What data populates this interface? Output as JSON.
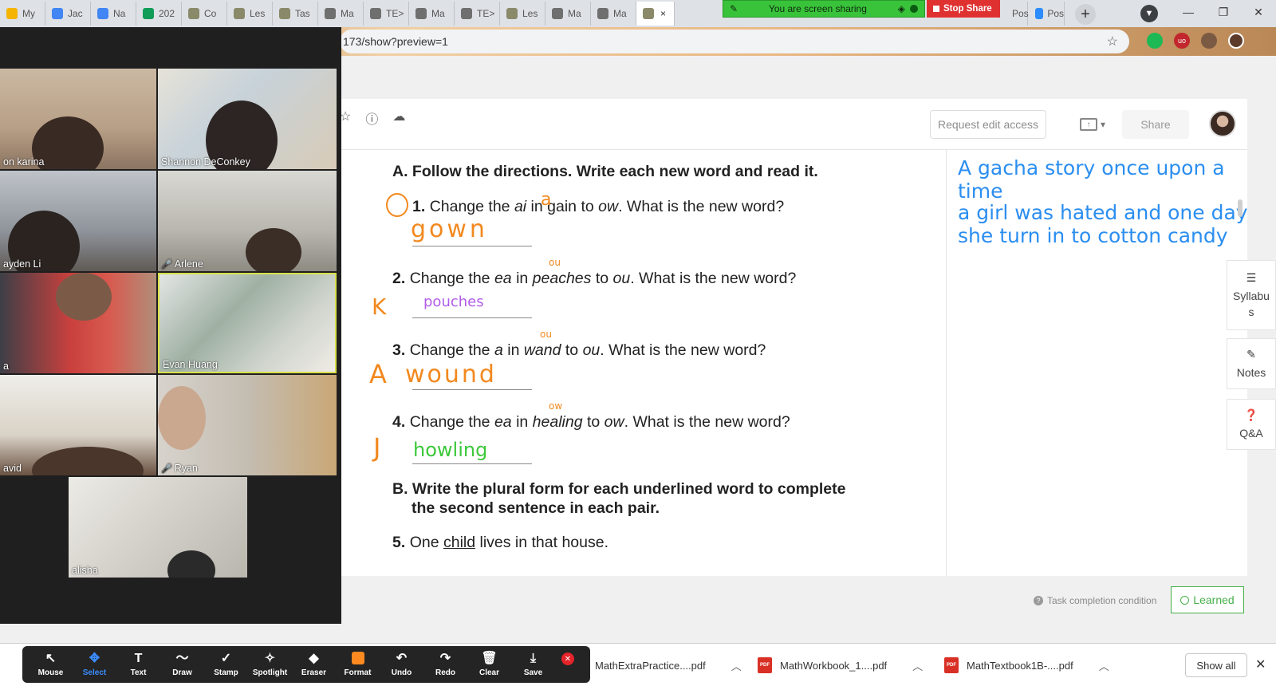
{
  "browser": {
    "tabs": [
      {
        "label": "My",
        "color": "#f4b400"
      },
      {
        "label": "Jac",
        "color": "#4285f4"
      },
      {
        "label": "Na",
        "color": "#4285f4"
      },
      {
        "label": "202",
        "color": "#0f9d58"
      },
      {
        "label": "Co",
        "color": "#8a8a6a"
      },
      {
        "label": "Les",
        "color": "#8a8a6a"
      },
      {
        "label": "Tas",
        "color": "#8a8a6a"
      },
      {
        "label": "Ma",
        "color": "#6f6f6f"
      },
      {
        "label": "TE>",
        "color": "#6f6f6f"
      },
      {
        "label": "Ma",
        "color": "#6f6f6f"
      },
      {
        "label": "TE>",
        "color": "#6f6f6f"
      },
      {
        "label": "Les",
        "color": "#8a8a6a"
      },
      {
        "label": "Ma",
        "color": "#6f6f6f"
      },
      {
        "label": "Ma",
        "color": "#6f6f6f"
      }
    ],
    "active_tab_close": "×",
    "sharing_text": "You are screen sharing",
    "stop_share_label": "Stop Share",
    "tab_right_1": "Pos",
    "tab_right_2": "Pos",
    "address": "173/show?preview=1"
  },
  "doc_header": {
    "request_edit_label": "Request edit access",
    "share_label": "Share"
  },
  "worksheet": {
    "section_a": "A. Follow the directions. Write each new word and read it.",
    "q1": {
      "num": "1.",
      "pre": "Change the ",
      "from": "ai",
      "mid1": " in ",
      "word": "gain",
      "mid2": " to ",
      "to": "ow",
      "post": ". What is the new word?"
    },
    "q2": {
      "num": "2.",
      "pre": "Change the ",
      "from": "ea",
      "mid1": " in ",
      "word": "peaches",
      "mid2": " to ",
      "to": "ou",
      "post": ". What is the new word?"
    },
    "q3": {
      "num": "3.",
      "pre": "Change the ",
      "from": "a",
      "mid1": " in ",
      "word": "wand",
      "mid2": " to ",
      "to": "ou",
      "post": ". What is the new word?"
    },
    "q4": {
      "num": "4.",
      "pre": "Change the ",
      "from": "ea",
      "mid1": " in ",
      "word": "healing",
      "mid2": " to ",
      "to": "ow",
      "post": ". What is the new word?"
    },
    "answers": {
      "a1": "gown",
      "a2": "pouches",
      "a3": "wound",
      "a4": "howling"
    },
    "initials": {
      "q2": "K",
      "q3": "A",
      "q4": "J"
    },
    "scribbles": {
      "q1": "a",
      "q2": "ou",
      "q3": "ou",
      "q4": "ow"
    },
    "section_b_line1": "B. Write the plural form for each underlined word to complete",
    "section_b_line2": "the second sentence in each pair.",
    "q5": {
      "num": "5.",
      "pre": "One ",
      "word": "child",
      "post": " lives in that house."
    }
  },
  "notes": {
    "line1": "A gacha story once upon a time",
    "line2": "a girl was hated and one day she turn in to cotton candy"
  },
  "side_panel": {
    "syllabus_label": "Syllabus",
    "notes_label": "Notes",
    "qa_label": "Q&A"
  },
  "footer": {
    "task_completion": "Task completion condition",
    "learned_label": "Learned"
  },
  "zoom": {
    "participants": [
      {
        "id": "karina",
        "name": "on karina",
        "muted": false
      },
      {
        "id": "shannon",
        "name": "Shannon DeConkey",
        "muted": false
      },
      {
        "id": "jayden",
        "name": "ayden Li",
        "muted": false
      },
      {
        "id": "arlene",
        "name": "Arlene",
        "muted": true
      },
      {
        "id": "na",
        "name": "a",
        "muted": false
      },
      {
        "id": "evan",
        "name": "Evan Huang",
        "muted": false
      },
      {
        "id": "david",
        "name": "avid",
        "muted": false
      },
      {
        "id": "ryan",
        "name": "Ryan",
        "muted": true
      },
      {
        "id": "alisha",
        "name": "alisha",
        "muted": false
      }
    ],
    "tools": [
      {
        "id": "mouse",
        "label": "Mouse",
        "icon": "↖"
      },
      {
        "id": "select",
        "label": "Select",
        "icon": "✥"
      },
      {
        "id": "text",
        "label": "Text",
        "icon": "T"
      },
      {
        "id": "draw",
        "label": "Draw",
        "icon": "〜"
      },
      {
        "id": "stamp",
        "label": "Stamp",
        "icon": "✓"
      },
      {
        "id": "spotlight",
        "label": "Spotlight",
        "icon": "✧"
      },
      {
        "id": "eraser",
        "label": "Eraser",
        "icon": "◆"
      },
      {
        "id": "format",
        "label": "Format",
        "icon": ""
      },
      {
        "id": "undo",
        "label": "Undo",
        "icon": "↶"
      },
      {
        "id": "redo",
        "label": "Redo",
        "icon": "↷"
      },
      {
        "id": "clear",
        "label": "Clear",
        "icon": "🗑"
      },
      {
        "id": "save",
        "label": "Save",
        "icon": "⤓"
      }
    ],
    "selected_tool": "select",
    "format_color": "#ff8a1f"
  },
  "downloads": {
    "items": [
      {
        "file": "MathExtraPractice....pdf"
      },
      {
        "file": "MathWorkbook_1....pdf"
      },
      {
        "file": "MathTextbook1B-....pdf"
      }
    ],
    "show_all_label": "Show all"
  },
  "colors": {
    "answer_orange": "#f2891f",
    "answer_purple": "#b15ce8",
    "answer_green": "#3cc83a",
    "notes_blue": "#2b8ef0",
    "share_green": "#39c33a",
    "stop_red": "#e03131"
  }
}
